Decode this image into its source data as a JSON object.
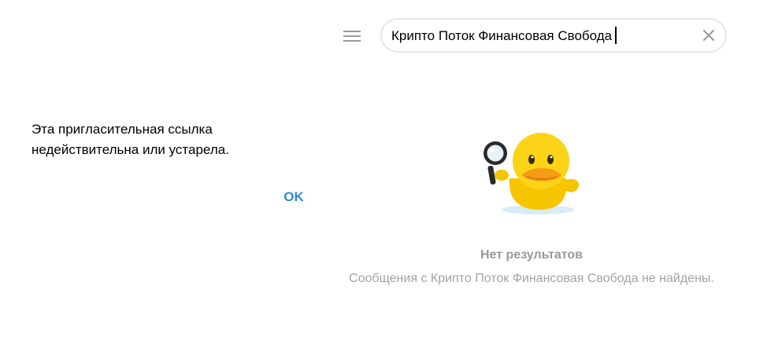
{
  "dialog": {
    "message": "Эта пригласительная ссылка недействительна или устарела.",
    "ok_label": "OK"
  },
  "header": {
    "menu_icon": "hamburger-menu-icon",
    "search": {
      "value": "Крипто Поток Финансовая Свобода",
      "clear_icon": "close-icon"
    }
  },
  "empty_state": {
    "sticker": "duck-with-magnifier-sticker",
    "title": "Нет результатов",
    "description": "Сообщения с Крипто Поток Финансовая Свобода не найдены."
  },
  "colors": {
    "accent": "#2f8bd6",
    "muted_text": "#a3a3a3",
    "icon": "#999999",
    "duck_yellow": "#f9c800"
  }
}
